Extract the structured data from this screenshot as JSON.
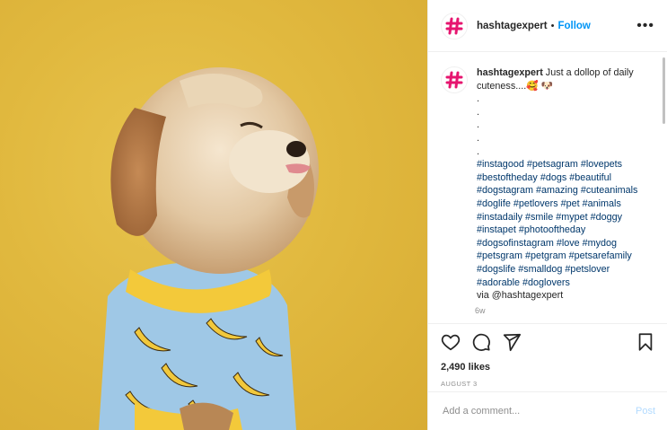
{
  "post": {
    "image_alt": "Dog in banana pajamas against yellow background"
  },
  "header": {
    "username": "hashtagexpert",
    "separator": "•",
    "follow_label": "Follow",
    "more_label": "•••"
  },
  "caption": {
    "username": "hashtagexpert",
    "text": " Just a dollop of daily cuteness....🥰 🐶\n.\n.\n.\n.\n.\n",
    "hashtags": "#instagood #petsagram #lovepets #bestoftheday #dogs #beautiful #dogstagram #amazing #cuteanimals #doglife #petlovers #pet #animals #instadaily #smile #mypet #doggy #instapet #photooftheday #dogsofinstagram #love #mydog #petsgram #petgram #petsarefamily #dogslife #smalldog #petslover #adorable #doglovers",
    "via": "\nvia @hashtagexpert",
    "time_ago": "6w"
  },
  "actions": {
    "likes": "2,490 likes",
    "date": "AUGUST 3"
  },
  "comment_box": {
    "placeholder": "Add a comment...",
    "post_label": "Post"
  },
  "colors": {
    "accent": "#0095f6",
    "avatar": "#e6156f",
    "background_yellow": "#e1b93f"
  }
}
